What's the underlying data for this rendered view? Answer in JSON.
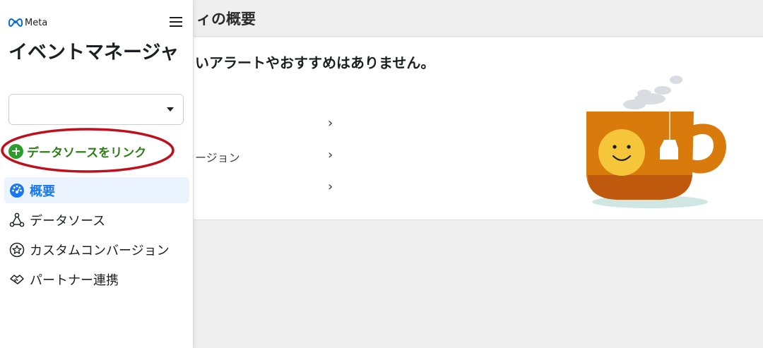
{
  "header": {
    "page_title": "ィの概要"
  },
  "card": {
    "alert_text": "いアラートやおすすめはありません。",
    "rows": [
      {
        "label": "",
        "chevron": "›"
      },
      {
        "label": "ージョン",
        "chevron": "›"
      },
      {
        "label": "",
        "chevron": "›"
      }
    ]
  },
  "sidebar": {
    "brand": "Meta",
    "app_title": "イベントマネージャ",
    "account_select_value": "",
    "link_data_source_label": "データソースをリンク",
    "nav_items": [
      {
        "label": "概要",
        "icon": "dashboard-gauge-icon",
        "active": true
      },
      {
        "label": "データソース",
        "icon": "data-source-network-icon",
        "active": false
      },
      {
        "label": "カスタムコンバージョン",
        "icon": "star-badge-icon",
        "active": false
      },
      {
        "label": "パートナー連携",
        "icon": "handshake-icon",
        "active": false
      }
    ]
  },
  "colors": {
    "accent_blue": "#1877f2",
    "link_green": "#2e7d1a",
    "annotation_red": "#c0101e",
    "cup_orange": "#d97a0c",
    "smiley_yellow": "#f5c53a"
  }
}
